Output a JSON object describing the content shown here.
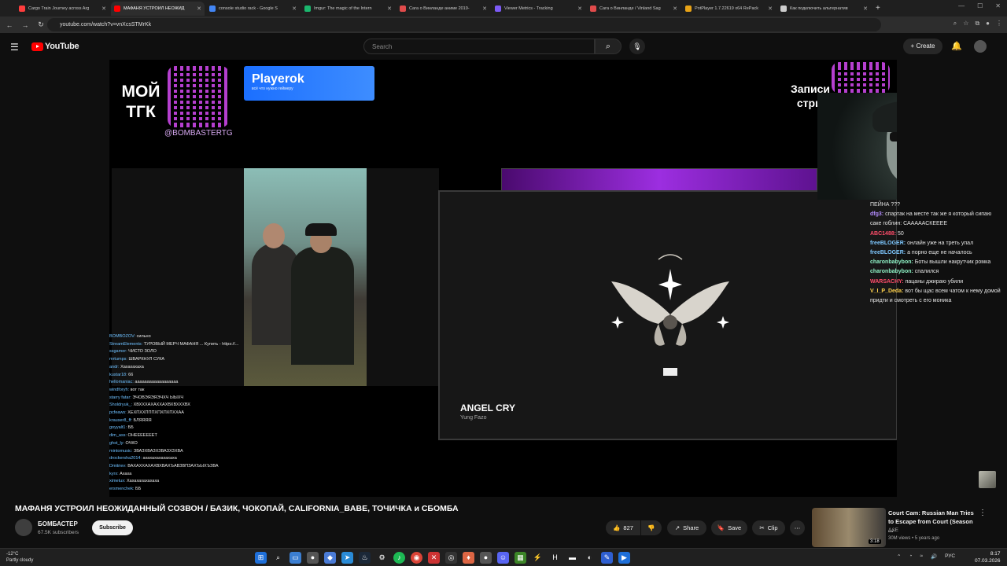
{
  "browser": {
    "tabs": [
      {
        "title": "Cargo Train Journey across Arg",
        "color": "#ff3d3d"
      },
      {
        "title": "МАФАНЯ УСТРОИЛ НЕОЖИД",
        "color": "#ff0000",
        "active": true
      },
      {
        "title": "console studio rack - Google S",
        "color": "#4285f4"
      },
      {
        "title": "Imgur: The magic of the Intern",
        "color": "#1bb76e"
      },
      {
        "title": "Сага о Винланде аниме 2019-",
        "color": "#e14b4b"
      },
      {
        "title": "Viewer Metrics - Tracking",
        "color": "#7d5bf6"
      },
      {
        "title": "Сага о Винланде / Vinland Sag",
        "color": "#e14b4b"
      },
      {
        "title": "PotPlayer 1.7.22619 x64 RePack",
        "color": "#e8a317"
      },
      {
        "title": "Как подключить альтернатив",
        "color": "#cccccc"
      }
    ],
    "url": "youtube.com/watch?v=vnXcsSTMrKk"
  },
  "youtube": {
    "logo": "YouTube",
    "search_placeholder": "Search",
    "create_label": "Create"
  },
  "overlay": {
    "tgk_line1": "МОЙ",
    "tgk_line2": "ТГК",
    "tg_handle": "@BOMBASTERTG",
    "playerok_name": "Playerok",
    "playerok_sub": "всё что нужно геймеру",
    "zapisi_line1": "Записи",
    "zapisi_line2": "стрим"
  },
  "now_playing": {
    "song": "ANGEL CRY",
    "artist": "Yung Fazo",
    "label": "PARENTAL ADVISORY"
  },
  "chat_left": [
    {
      "user": "BOMBOZOV:",
      "msg": "сильно"
    },
    {
      "user": "StreamElements:",
      "msg": "ТУРОВЫЙ МЕРЧ МАФАНЯ ... Купить - https://..."
    },
    {
      "user": "ssgamer:",
      "msg": "ЧИСТО ЗОЛО"
    },
    {
      "user": "mrtumps:",
      "msg": "ШВАРКНУЛ СУКА"
    },
    {
      "user": "andr:",
      "msg": "Хахахахаха"
    },
    {
      "user": "kustar18:",
      "msg": "66"
    },
    {
      "user": "hellomaniac:",
      "msg": "аааааааааааааааааа"
    },
    {
      "user": "windforyh:",
      "msg": "вот так"
    },
    {
      "user": "starry fatar:",
      "msg": "ЭЧОВЭЯЭЯЭЧХЧ ЫЫХЧ"
    },
    {
      "user": "Sholdryuk_:",
      "msg": "ХВХХХАХАХХАХВХВХХХВХ"
    },
    {
      "user": "pcfeaws:",
      "msg": "ХЕХПХХПППХПХПХПХХАА"
    },
    {
      "user": "krauser8_ff:",
      "msg": "БЛЯЯЯЯ"
    },
    {
      "user": "goyyalt1:",
      "msg": "ББ"
    },
    {
      "user": "dim_ass:",
      "msg": "ОНЕЕЕЕЕЕЕТ"
    },
    {
      "user": "ghst_ly:",
      "msg": "ОЧКО"
    },
    {
      "user": "mintomusic:",
      "msg": "ЗВАЗХВАЗХЗВАЗХЗХВА"
    },
    {
      "user": "drockersha2014:",
      "msg": "ахахахахахахаха"
    },
    {
      "user": "Dmitriev:",
      "msg": "ВАХАХХАХАХВХВАХЪАВЗВПЗАХЪЫХЪЗВА"
    },
    {
      "user": "kyrx:",
      "msg": "Ахаха"
    },
    {
      "user": "ximetux:",
      "msg": "Хахахахахахаха"
    },
    {
      "user": "ersmenchek:",
      "msg": "ББ"
    }
  ],
  "chat_right": [
    {
      "user": "",
      "msg": "ПЕЙНА ???",
      "color": "#ffffff"
    },
    {
      "user": "dfg3:",
      "msg": "спартак на месте так же я который сипаю саке гоблин: САААААСКЕЕЕЕ",
      "color": "#b48cff"
    },
    {
      "user": "ABC1488:",
      "msg": "50",
      "color": "#ff4d6a"
    },
    {
      "user": "freeBLOGER:",
      "msg": "онлайн уже на треть упал",
      "color": "#7ec8ff"
    },
    {
      "user": "freeBLOGER:",
      "msg": "а порно еще не началось",
      "color": "#7ec8ff"
    },
    {
      "user": "charonbabybon:",
      "msg": "Боты вышли накрутчик ромка",
      "color": "#8df0c4"
    },
    {
      "user": "charonbabybon:",
      "msg": "спалился",
      "color": "#8df0c4"
    },
    {
      "user": "WARSACHY:",
      "msg": "пацаны джираю убили",
      "color": "#ff4d6a"
    },
    {
      "user": "V_I_P_Deda:",
      "msg": "вот бы щас всем чатом к нему домой придти и смотреть с его моника",
      "color": "#ffd24d"
    }
  ],
  "video": {
    "title": "МАФАНЯ УСТРОИЛ НЕОЖИДАННЫЙ СОЗВОН / БАЗИК, ЧОКОПАЙ, CALIFORNIA_BABE, ТОЧИЧКА и СБОМБА",
    "channel": "БОМБАСТЕР",
    "subscribers": "67.5K subscribers",
    "subscribe_label": "Subscribe",
    "likes": "827",
    "share_label": "Share",
    "save_label": "Save",
    "clip_label": "Clip"
  },
  "recommended": {
    "title": "Court Cam: Russian Man Tries to Escape from Court (Season ...",
    "channel": "A&E",
    "meta": "30M views • 5 years ago",
    "duration": "3:18"
  },
  "taskbar": {
    "temp": "-12°C",
    "weather": "Partly cloudy",
    "lang": "РУС",
    "time": "8:17",
    "date": "07.03.2026"
  }
}
